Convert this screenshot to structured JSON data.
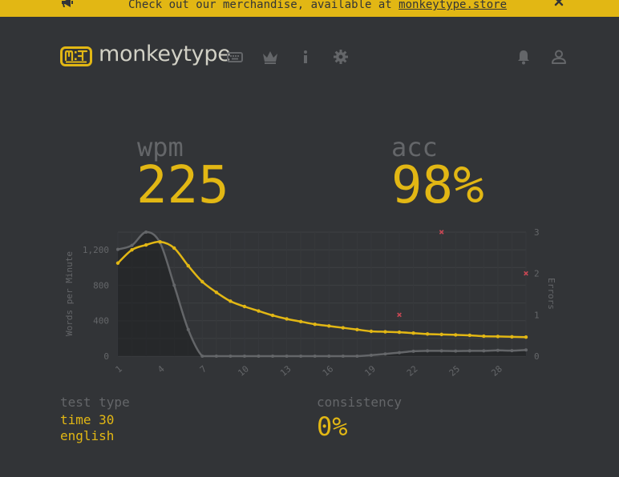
{
  "banner": {
    "text": "Check out our merchandise, available at ",
    "link": "monkeytype.store"
  },
  "header": {
    "logo_text": "monkeytype",
    "nav_icons": [
      "keyboard-icon",
      "crown-icon",
      "info-icon",
      "gear-icon"
    ],
    "right_icons": [
      "bell-icon",
      "user-icon"
    ]
  },
  "stats": {
    "wpm_label": "wpm",
    "wpm_value": "225",
    "acc_label": "acc",
    "acc_value": "98%"
  },
  "details": {
    "test_type_label": "test type",
    "test_type_value": "time 30",
    "language": "english",
    "consistency_label": "consistency",
    "consistency_value": "0%"
  },
  "colors": {
    "background": "#323437",
    "main": "#e2b714",
    "sub": "#646669",
    "text": "#d1d0c5",
    "error": "#ca4754",
    "raw_line": "#646669"
  },
  "chart_data": {
    "type": "line",
    "x": [
      1,
      2,
      3,
      4,
      5,
      6,
      7,
      8,
      9,
      10,
      11,
      12,
      13,
      14,
      15,
      16,
      17,
      18,
      19,
      20,
      21,
      22,
      23,
      24,
      25,
      26,
      27,
      28,
      29,
      30
    ],
    "xticks": [
      "1",
      "4",
      "7",
      "10",
      "13",
      "16",
      "19",
      "22",
      "25",
      "28"
    ],
    "ylabel": "Words per Minute",
    "y2label": "Errors",
    "ylim": [
      0,
      1400
    ],
    "yticks": [
      "0",
      "400",
      "800",
      "1,200"
    ],
    "y2lim": [
      0,
      3
    ],
    "y2ticks": [
      "0",
      "1",
      "2",
      "3"
    ],
    "grid": true,
    "series": [
      {
        "role": "wpm",
        "values": [
          1050,
          1200,
          1255,
          1290,
          1220,
          1020,
          840,
          720,
          620,
          560,
          510,
          460,
          420,
          390,
          360,
          340,
          320,
          300,
          280,
          275,
          270,
          260,
          250,
          245,
          240,
          235,
          225,
          222,
          218,
          215
        ]
      },
      {
        "role": "raw",
        "values": [
          1205,
          1250,
          1400,
          1280,
          800,
          300,
          0,
          0,
          0,
          0,
          0,
          0,
          0,
          0,
          0,
          0,
          0,
          0,
          10,
          25,
          40,
          55,
          60,
          60,
          58,
          60,
          60,
          65,
          62,
          70
        ]
      },
      {
        "role": "errors",
        "points": [
          [
            21,
            1
          ],
          [
            24,
            3
          ],
          [
            30,
            2
          ]
        ]
      }
    ]
  }
}
